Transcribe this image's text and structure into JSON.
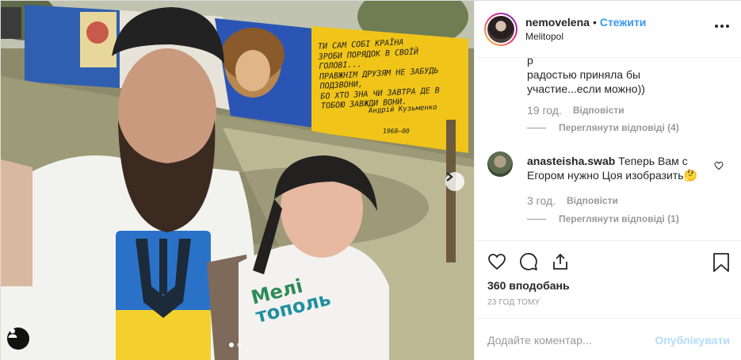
{
  "photo": {
    "mural_quote": "ТИ САМ СОБІ КРАЇНА\nЗРОБИ ПОРЯДОК В СВОЇЙ ГОЛОВІ...\nПРАВЖНІМ ДРУЗЯМ НЕ ЗАБУДЬ ПОДЗВОНИ,\nБО ХТО ЗНА ЧИ ЗАВТРА ДЕ В ТОБОЮ ЗАВЖДИ ВОНИ.",
    "mural_signature": "Андрій Кузьменко",
    "mural_years": "1968—00",
    "shirt_line1": "Мелі",
    "shirt_line2": "тополь",
    "slide_count": 2,
    "active_slide": 1
  },
  "header": {
    "username": "nemovelena",
    "separator": "•",
    "follow_label": "Стежити",
    "location": "Melitopol"
  },
  "comments": [
    {
      "text_lines": [
        "радостью приняла бы",
        "участие...если можно))"
      ],
      "time": "19 год.",
      "reply_label": "Відповісти",
      "view_replies": "Переглянути відповіді (4)"
    },
    {
      "username": "anasteisha.swab",
      "text_line1": "Теперь Вам с",
      "text_line2": "Егором нужно Цоя изобразить🤔",
      "time": "3 год.",
      "reply_label": "Відповісти",
      "view_replies": "Переглянути відповіді (1)"
    }
  ],
  "actions": {
    "likes": "360 вподобань",
    "time_ago": "23 ГОД ТОМУ"
  },
  "comment_box": {
    "placeholder": "Додайте коментар...",
    "post_label": "Опублікувати"
  },
  "colors": {
    "link_blue": "#3897f0",
    "post_disabled": "#b3dbff",
    "muted": "#999999"
  }
}
